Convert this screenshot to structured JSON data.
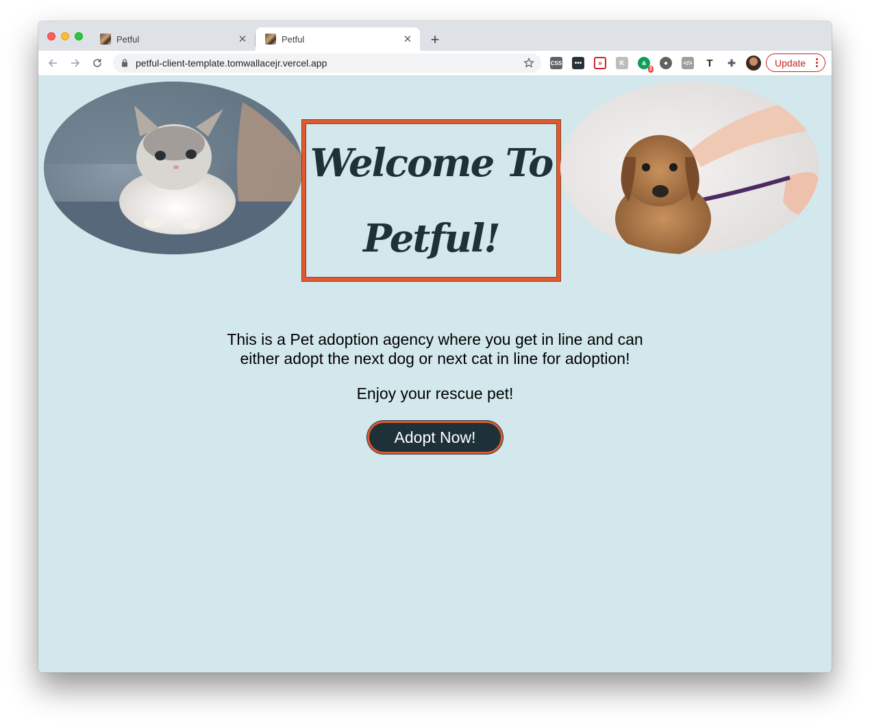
{
  "browser": {
    "tabs": [
      {
        "title": "Petful",
        "active": false
      },
      {
        "title": "Petful",
        "active": true
      }
    ],
    "url": "petful-client-template.tomwallacejr.vercel.app",
    "update_label": "Update",
    "extension_badge": "3"
  },
  "page": {
    "heading": "Welcome To Petful!",
    "description": "This is a Pet adoption agency where you get in line and can either adopt the next dog or next cat in line for adoption!",
    "enjoy_text": "Enjoy your rescue pet!",
    "adopt_button_label": "Adopt Now!"
  },
  "colors": {
    "background": "#d3e8ed",
    "accent": "#e05a2e",
    "dark": "#1f3138"
  }
}
